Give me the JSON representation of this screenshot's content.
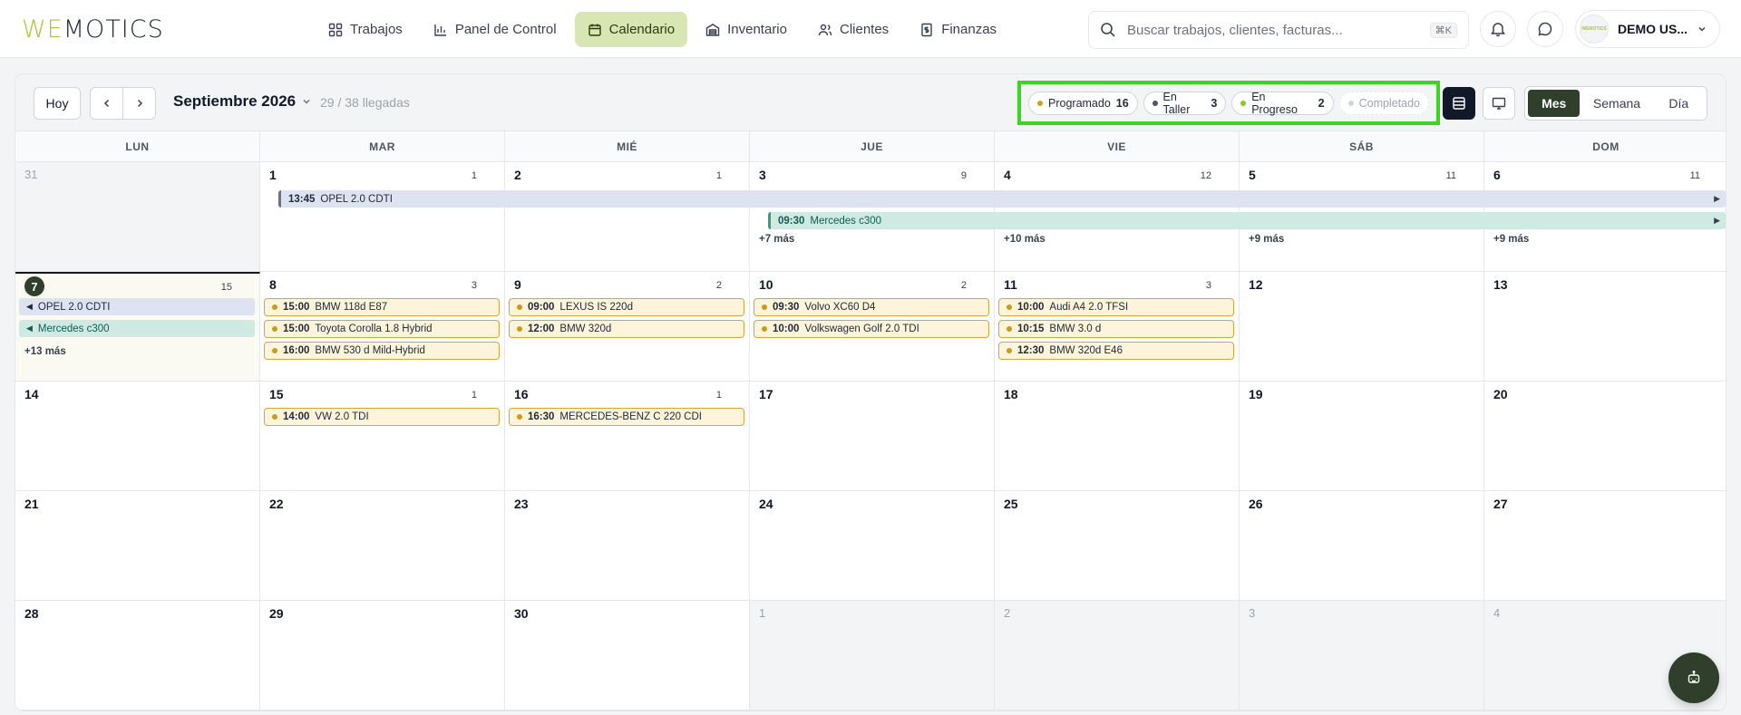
{
  "brand": {
    "logo_we": "WE",
    "logo_rest": "MOTICS",
    "accent": "#a3c93a"
  },
  "nav": {
    "items": [
      {
        "label": "Trabajos",
        "icon": "grid-icon"
      },
      {
        "label": "Panel de Control",
        "icon": "bar-chart-icon"
      },
      {
        "label": "Calendario",
        "icon": "calendar-icon",
        "active": true
      },
      {
        "label": "Inventario",
        "icon": "warehouse-icon"
      },
      {
        "label": "Clientes",
        "icon": "users-icon"
      },
      {
        "label": "Finanzas",
        "icon": "dollar-file-icon"
      }
    ]
  },
  "search": {
    "placeholder": "Buscar trabajos, clientes, facturas...",
    "shortcut": "⌘K"
  },
  "user": {
    "name": "DEMO US...",
    "avatar_text": "WEMOTICS"
  },
  "toolbar": {
    "today_label": "Hoy",
    "month_label": "Septiembre 2026",
    "arrivals": "29 / 38 llegadas",
    "status_pills": [
      {
        "label": "Programado",
        "count": "16",
        "color": "#d4a017"
      },
      {
        "label": "En Taller",
        "count": "3",
        "color": "#4b5563"
      },
      {
        "label": "En Progreso",
        "count": "2",
        "color": "#84cc16"
      },
      {
        "label": "Completado",
        "count": "",
        "color": "#d1d5db"
      }
    ],
    "views": [
      "Mes",
      "Semana",
      "Día"
    ],
    "active_view": "Mes"
  },
  "weekdays": [
    "LUN",
    "MAR",
    "MIÉ",
    "JUE",
    "VIE",
    "SÁB",
    "DOM"
  ],
  "weeks": [
    [
      {
        "day": "31",
        "count": "",
        "out": true
      },
      {
        "day": "1",
        "count": "1"
      },
      {
        "day": "2",
        "count": "1"
      },
      {
        "day": "3",
        "count": "9"
      },
      {
        "day": "4",
        "count": "12"
      },
      {
        "day": "5",
        "count": "11"
      },
      {
        "day": "6",
        "count": "11"
      }
    ],
    [
      {
        "day": "7",
        "count": "15",
        "today": true
      },
      {
        "day": "8",
        "count": "3"
      },
      {
        "day": "9",
        "count": "2"
      },
      {
        "day": "10",
        "count": "2"
      },
      {
        "day": "11",
        "count": "3"
      },
      {
        "day": "12",
        "count": ""
      },
      {
        "day": "13",
        "count": ""
      }
    ],
    [
      {
        "day": "14",
        "count": ""
      },
      {
        "day": "15",
        "count": "1"
      },
      {
        "day": "16",
        "count": "1"
      },
      {
        "day": "17",
        "count": ""
      },
      {
        "day": "18",
        "count": ""
      },
      {
        "day": "19",
        "count": ""
      },
      {
        "day": "20",
        "count": ""
      }
    ],
    [
      {
        "day": "21",
        "count": ""
      },
      {
        "day": "22",
        "count": ""
      },
      {
        "day": "23",
        "count": ""
      },
      {
        "day": "24",
        "count": ""
      },
      {
        "day": "25",
        "count": ""
      },
      {
        "day": "26",
        "count": ""
      },
      {
        "day": "27",
        "count": ""
      }
    ],
    [
      {
        "day": "28",
        "count": ""
      },
      {
        "day": "29",
        "count": ""
      },
      {
        "day": "30",
        "count": ""
      },
      {
        "day": "1",
        "count": "",
        "out": true
      },
      {
        "day": "2",
        "count": "",
        "out": true
      },
      {
        "day": "3",
        "count": "",
        "out": true
      },
      {
        "day": "4",
        "count": "",
        "out": true
      }
    ]
  ],
  "spanning_events": [
    {
      "time": "13:45",
      "title": "OPEL 2.0 CDTI",
      "style": "blue"
    },
    {
      "time": "09:30",
      "title": "Mercedes c300",
      "style": "teal"
    },
    {
      "time": "",
      "title": "OPEL 2.0 CDTI",
      "style": "blue"
    },
    {
      "time": "",
      "title": "Mercedes c300",
      "style": "teal"
    }
  ],
  "more_labels": {
    "w0_thu": "+7 más",
    "w0_fri": "+10 más",
    "w0_sat": "+9 más",
    "w0_sun": "+9 más",
    "w1_mon": "+13 más"
  },
  "events": {
    "w1_tue": [
      {
        "time": "15:00",
        "title": "BMW 118d E87"
      },
      {
        "time": "15:00",
        "title": "Toyota Corolla 1.8 Hybrid"
      },
      {
        "time": "16:00",
        "title": "BMW 530 d Mild-Hybrid"
      }
    ],
    "w1_wed": [
      {
        "time": "09:00",
        "title": "LEXUS IS 220d"
      },
      {
        "time": "12:00",
        "title": "BMW 320d"
      }
    ],
    "w1_thu": [
      {
        "time": "09:30",
        "title": "Volvo XC60 D4"
      },
      {
        "time": "10:00",
        "title": "Volkswagen Golf 2.0 TDI"
      }
    ],
    "w1_fri": [
      {
        "time": "10:00",
        "title": "Audi A4 2.0 TFSI"
      },
      {
        "time": "10:15",
        "title": "BMW 3.0 d"
      },
      {
        "time": "12:30",
        "title": "BMW 320d E46"
      }
    ],
    "w2_tue": [
      {
        "time": "14:00",
        "title": "VW 2.0 TDI"
      }
    ],
    "w2_wed": [
      {
        "time": "16:30",
        "title": "MERCEDES-BENZ C 220 CDI"
      }
    ]
  }
}
